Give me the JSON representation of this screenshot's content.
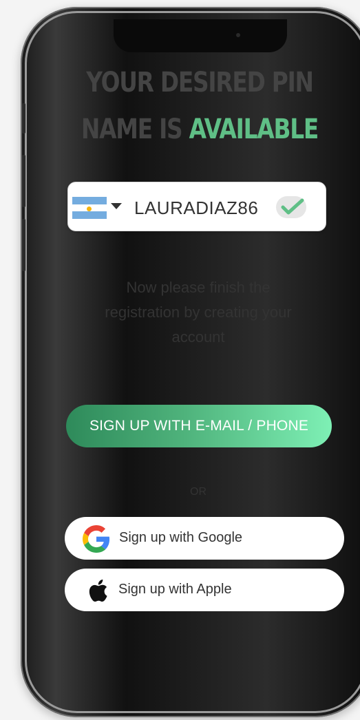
{
  "header": {
    "title_line1": "YOUR DESIRED PIN",
    "title_line2_prefix": "NAME IS ",
    "title_line2_accent": "AVAILABLE"
  },
  "pin_field": {
    "country_flag": "argentina-flag",
    "value": "LAURADIAZ86",
    "status_icon": "check-icon"
  },
  "message": "Now please finish the registration by creating your account",
  "signup_email": {
    "label": "SIGN UP WITH E-MAIL / PHONE"
  },
  "divider": "OR",
  "social": {
    "google": {
      "label": "Sign up with Google",
      "icon": "google-icon"
    },
    "apple": {
      "label": "Sign up with Apple",
      "icon": "apple-icon"
    }
  },
  "colors": {
    "accent": "#5fbf86",
    "cta_gradient_start": "#2e8a5a",
    "cta_gradient_end": "#7ef0b5",
    "check": "#5fbf86"
  }
}
